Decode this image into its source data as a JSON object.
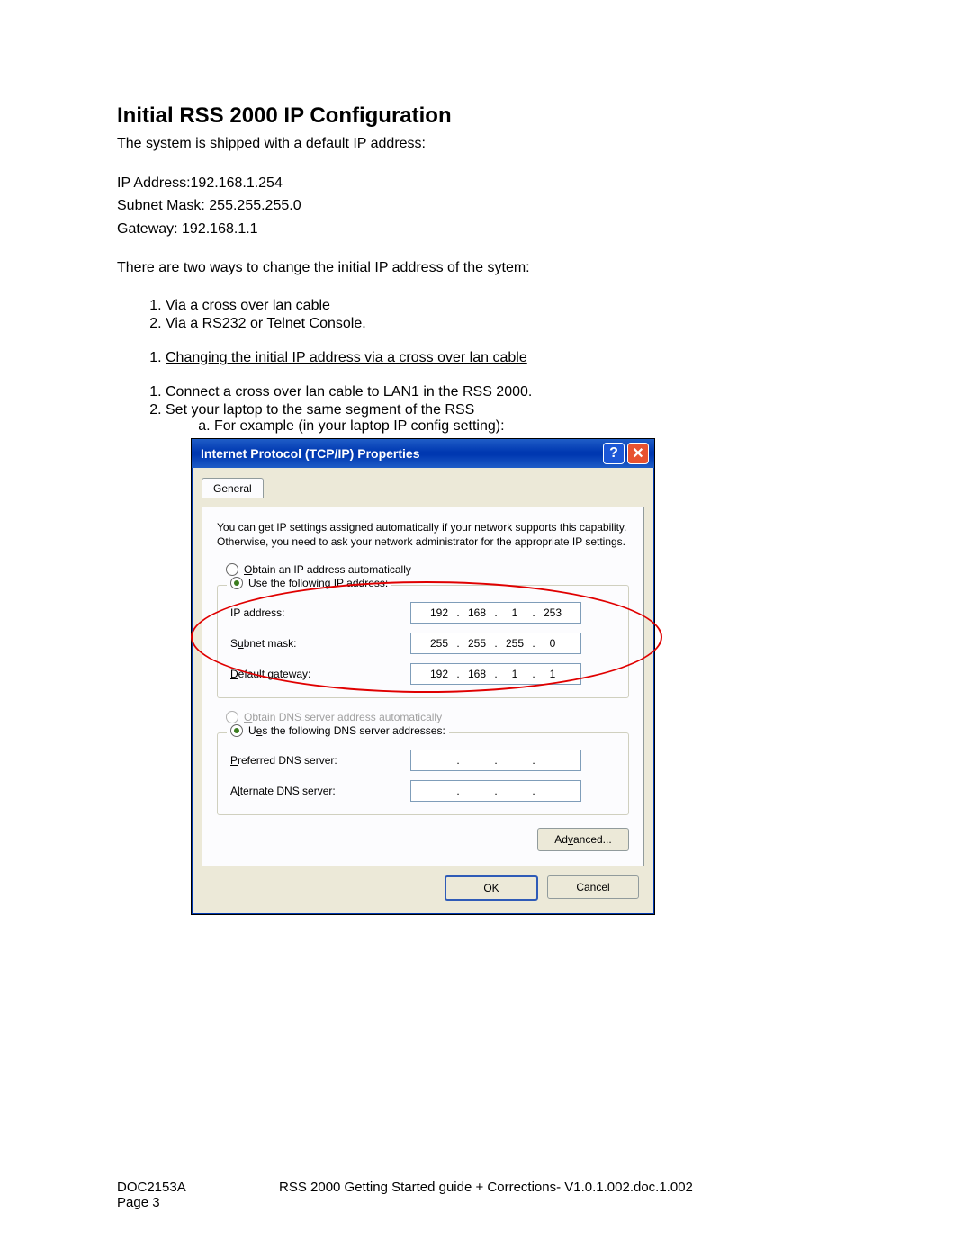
{
  "doc": {
    "heading": "Initial RSS 2000 IP Configuration",
    "intro": "The system is shipped with a default IP address:",
    "defaults": {
      "ip_line": "IP Address:192.168.1.254",
      "subnet_line": "Subnet Mask: 255.255.255.0",
      "gateway_line": "Gateway: 192.168.1.1"
    },
    "ways_intro": "There are two ways to change the initial IP address of the sytem:",
    "ways": [
      "Via a cross over lan cable",
      "Via a RS232 or Telnet Console."
    ],
    "section1_title": "Changing the initial IP address via a cross over lan cable",
    "steps": [
      "Connect a cross over lan cable to LAN1 in the RSS 2000.",
      "Set your laptop to the same segment of the RSS"
    ],
    "substep_a": "For example (in your laptop IP config setting):"
  },
  "dialog": {
    "title": "Internet Protocol (TCP/IP) Properties",
    "help_glyph": "?",
    "close_glyph": "✕",
    "tab_general": "General",
    "explain": "You can get IP settings assigned automatically if your network supports this capability. Otherwise, you need to ask your network administrator for the appropriate IP settings.",
    "radio_auto_ip": "btain an IP address automatically",
    "radio_auto_ip_u": "O",
    "radio_use_ip": "se the following IP address:",
    "radio_use_ip_u": "U",
    "labels": {
      "ip_u": "I",
      "ip_rest": "P address:",
      "subnet_pre": "S",
      "subnet_u": "u",
      "subnet_rest": "bnet mask:",
      "gw_u": "D",
      "gw_rest": "efault gateway:"
    },
    "ip_addr": [
      "192",
      "168",
      "1",
      "253"
    ],
    "subnet": [
      "255",
      "255",
      "255",
      "0"
    ],
    "gateway": [
      "192",
      "168",
      "1",
      "1"
    ],
    "radio_auto_dns": "btain DNS server address automatically",
    "radio_auto_dns_u": "O",
    "radio_use_dns": "s the following DNS server addresses:",
    "radio_use_dns_pre": "U",
    "radio_use_dns_u": "e",
    "labels2": {
      "pref_u": "P",
      "pref_rest": "referred DNS server:",
      "alt_pre": "A",
      "alt_u": "l",
      "alt_rest": "ternate DNS server:"
    },
    "pref_dns": [
      "",
      "",
      "",
      ""
    ],
    "alt_dns": [
      "",
      "",
      "",
      ""
    ],
    "advanced_pre": "Ad",
    "advanced_u": "v",
    "advanced_rest": "anced...",
    "ok": "OK",
    "cancel": "Cancel"
  },
  "footer": {
    "doc_id": "DOC2153A",
    "title": "RSS 2000 Getting Started guide + Corrections- V1.0.1.002.doc.1.002",
    "page": "Page 3"
  }
}
